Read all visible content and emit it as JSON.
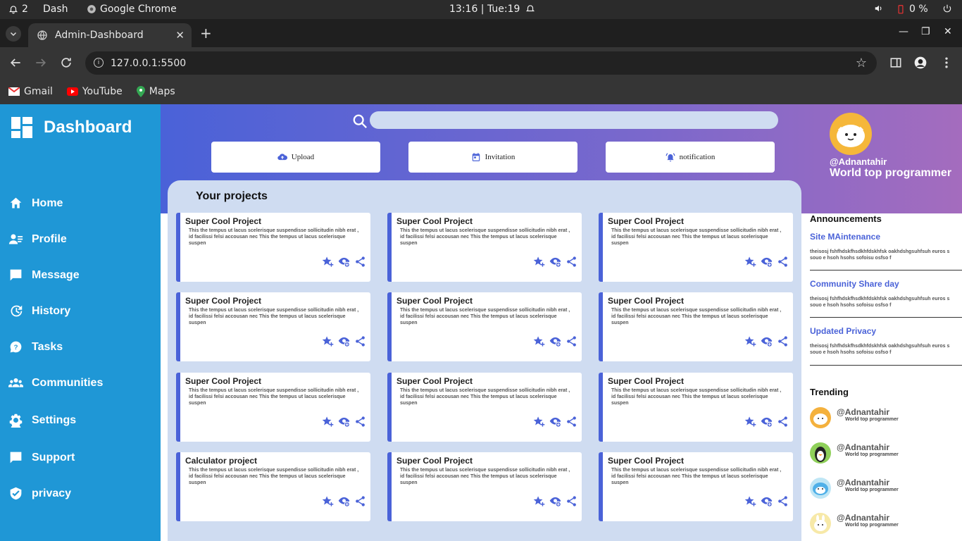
{
  "os": {
    "notifications": "2",
    "app_name": "Dash",
    "browser_name": "Google Chrome",
    "clock": "13:16 | Tue:19",
    "battery": "0 %"
  },
  "browser": {
    "tab_title": "Admin-Dashboard",
    "url": "127.0.0.1:5500",
    "bookmarks": [
      "Gmail",
      "YouTube",
      "Maps"
    ]
  },
  "sidebar": {
    "brand": "Dashboard",
    "items": [
      {
        "label": "Home",
        "icon": "home-icon"
      },
      {
        "label": "Profile",
        "icon": "profile-icon"
      },
      {
        "label": "Message",
        "icon": "message-icon"
      },
      {
        "label": "History",
        "icon": "history-icon"
      },
      {
        "label": "Tasks",
        "icon": "tasks-icon"
      },
      {
        "label": "Communities",
        "icon": "communities-icon"
      },
      {
        "label": "Settings",
        "icon": "settings-icon"
      },
      {
        "label": "Support",
        "icon": "support-icon"
      },
      {
        "label": "privacy",
        "icon": "privacy-icon"
      }
    ]
  },
  "header": {
    "search_placeholder": "",
    "actions": [
      "Upload",
      "Invitation",
      "notification"
    ]
  },
  "profile": {
    "handle": "@Adnantahir",
    "tagline": "World top programmer"
  },
  "projects": {
    "title": "Your projects",
    "cards": [
      {
        "title": "Super Cool Project",
        "desc": "This the tempus ut lacus scelerisque suspendisse sollicitudin nibh erat , id facilissi felsi accousan nec This the tempus ut lacus scelerisque suspen"
      },
      {
        "title": "Super Cool Project",
        "desc": "This the tempus ut lacus scelerisque suspendisse sollicitudin nibh erat , id facilissi felsi accousan nec This the tempus ut lacus scelerisque suspen"
      },
      {
        "title": "Super Cool Project",
        "desc": "This the tempus ut lacus scelerisque suspendisse sollicitudin nibh erat , id facilissi felsi accousan nec This the tempus ut lacus scelerisque suspen"
      },
      {
        "title": "Super Cool Project",
        "desc": "This the tempus ut lacus scelerisque suspendisse sollicitudin nibh erat , id facilissi felsi accousan nec This the tempus ut lacus scelerisque suspen"
      },
      {
        "title": "Super Cool Project",
        "desc": "This the tempus ut lacus scelerisque suspendisse sollicitudin nibh erat , id facilissi felsi accousan nec This the tempus ut lacus scelerisque suspen"
      },
      {
        "title": "Super Cool Project",
        "desc": "This the tempus ut lacus scelerisque suspendisse sollicitudin nibh erat , id facilissi felsi accousan nec This the tempus ut lacus scelerisque suspen"
      },
      {
        "title": "Super Cool Project",
        "desc": "This the tempus ut lacus scelerisque suspendisse sollicitudin nibh erat , id facilissi felsi accousan nec This the tempus ut lacus scelerisque suspen"
      },
      {
        "title": "Super Cool Project",
        "desc": "This the tempus ut lacus scelerisque suspendisse sollicitudin nibh erat , id facilissi felsi accousan nec This the tempus ut lacus scelerisque suspen"
      },
      {
        "title": "Super Cool Project",
        "desc": "This the tempus ut lacus scelerisque suspendisse sollicitudin nibh erat , id facilissi felsi accousan nec This the tempus ut lacus scelerisque suspen"
      },
      {
        "title": "Calculator project",
        "desc": "This the tempus ut lacus scelerisque suspendisse sollicitudin nibh erat , id facilissi felsi accousan nec This the tempus ut lacus scelerisque suspen"
      },
      {
        "title": "Super Cool Project",
        "desc": "This the tempus ut lacus scelerisque suspendisse sollicitudin nibh erat , id facilissi felsi accousan nec This the tempus ut lacus scelerisque suspen"
      },
      {
        "title": "Super Cool Project",
        "desc": "This the tempus ut lacus scelerisque suspendisse sollicitudin nibh erat , id facilissi felsi accousan nec This the tempus ut lacus scelerisque suspen"
      }
    ]
  },
  "announcements": {
    "title": "Announcements",
    "items": [
      {
        "title": "Site MAintenance",
        "text": "theisosj fshfhdskfhsdkhfdskhfsk oakhdshgsuhfsuh euros s souo e hsoh hsohs sofoisu osfso f"
      },
      {
        "title": "Community Share day",
        "text": "theisosj fshfhdskfhsdkhfdskhfsk oakhdshgsuhfsuh euros s souo e hsoh hsohs sofoisu osfso f"
      },
      {
        "title": "Updated Privacy",
        "text": "theisosj fshfhdskfhsdkhfdskhfsk oakhdshgsuhfsuh euros s souo e hsoh hsohs sofoisu osfso f"
      }
    ]
  },
  "trending": {
    "title": "Trending",
    "items": [
      {
        "name": "@Adnantahir",
        "sub": "World top programmer"
      },
      {
        "name": "@Adnantahir",
        "sub": "World top programmer"
      },
      {
        "name": "@Adnantahir",
        "sub": "World top programmer"
      },
      {
        "name": "@Adnantahir",
        "sub": "World top programmer"
      }
    ]
  },
  "colors": {
    "sidebar": "#1f97d6",
    "accent": "#4a62d8",
    "panel": "#cfdcf1"
  }
}
